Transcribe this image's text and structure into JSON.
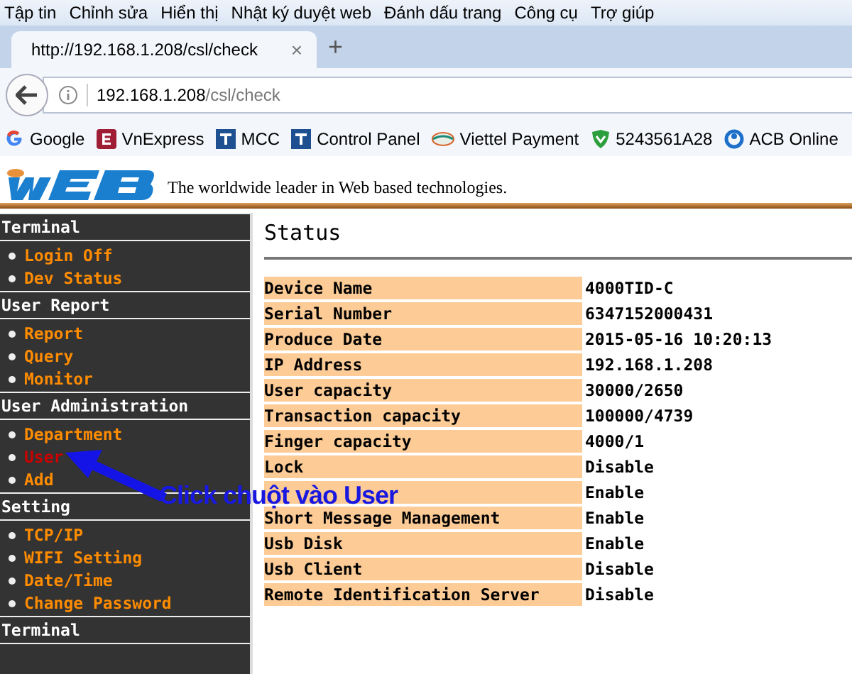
{
  "menu_bar": [
    "Tập tin",
    "Chỉnh sửa",
    "Hiển thị",
    "Nhật ký duyệt web",
    "Đánh dấu trang",
    "Công cụ",
    "Trợ giúp"
  ],
  "tabs": [
    {
      "label": "http://192.168.1.208/csl/check",
      "selected": true,
      "close": "×"
    }
  ],
  "new_tab": "+",
  "address_bar": {
    "host": "192.168.1.208",
    "path": "/csl/check"
  },
  "bookmarks": [
    {
      "label": "Google",
      "kind": "google"
    },
    {
      "label": "VnExpress",
      "kind": "vnexpress"
    },
    {
      "label": "MCC",
      "kind": "tile"
    },
    {
      "label": "Control Panel",
      "kind": "tile"
    },
    {
      "label": "Viettel Payment",
      "kind": "viettel"
    },
    {
      "label": "5243561A28",
      "kind": "shield"
    },
    {
      "label": "ACB Online",
      "kind": "ring"
    }
  ],
  "header": {
    "tagline": "The worldwide leader in Web based technologies."
  },
  "sidebar": [
    {
      "title": "Terminal",
      "items": [
        {
          "label": "Login Off",
          "selected": false
        },
        {
          "label": "Dev Status",
          "selected": false
        }
      ]
    },
    {
      "title": "User Report",
      "items": [
        {
          "label": "Report",
          "selected": false
        },
        {
          "label": "Query",
          "selected": false
        },
        {
          "label": "Monitor",
          "selected": false
        }
      ]
    },
    {
      "title": "User Administration",
      "items": [
        {
          "label": "Department",
          "selected": false
        },
        {
          "label": "User",
          "selected": true
        },
        {
          "label": "Add",
          "selected": false
        }
      ]
    },
    {
      "title": "Setting",
      "items": [
        {
          "label": "TCP/IP",
          "selected": false
        },
        {
          "label": "WIFI Setting",
          "selected": false
        },
        {
          "label": "Date/Time",
          "selected": false
        },
        {
          "label": "Change Password",
          "selected": false
        }
      ]
    },
    {
      "title": "Terminal"
    }
  ],
  "content": {
    "title": "Status",
    "rows": [
      {
        "label": "Device Name",
        "value": "4000TID-C"
      },
      {
        "label": "Serial Number",
        "value": "6347152000431"
      },
      {
        "label": "Produce Date",
        "value": "2015-05-16 10:20:13"
      },
      {
        "label": "IP Address",
        "value": "192.168.1.208"
      },
      {
        "label": "User capacity",
        "value": "30000/2650"
      },
      {
        "label": "Transaction capacity",
        "value": "100000/4739"
      },
      {
        "label": "Finger capacity",
        "value": "4000/1"
      },
      {
        "label": "Lock",
        "value": "Disable"
      },
      {
        "value": "Enable"
      },
      {
        "label": "Short Message Management",
        "value": "Enable"
      },
      {
        "label": "Usb Disk",
        "value": "Enable"
      },
      {
        "label": "Usb Client",
        "value": "Disable"
      },
      {
        "label": "Remote Identification Server",
        "value": "Disable"
      }
    ]
  },
  "annotation": {
    "text": "Click chuột vào User"
  }
}
